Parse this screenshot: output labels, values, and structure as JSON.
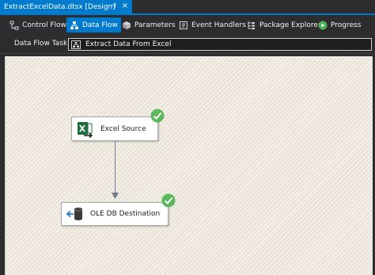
{
  "document_tab": {
    "title": "ExtractExcelData.dtsx [Design]",
    "pin_glyph": "⊣",
    "close_glyph": "×"
  },
  "toolbar": {
    "items": [
      {
        "label": "Control Flow",
        "icon": "control-flow-icon",
        "active": false
      },
      {
        "label": "Data Flow",
        "icon": "data-flow-icon",
        "active": true
      },
      {
        "label": "Parameters",
        "icon": "parameters-icon",
        "active": false
      },
      {
        "label": "Event Handlers",
        "icon": "event-handlers-icon",
        "active": false
      },
      {
        "label": "Package Explorer",
        "icon": "package-explorer-icon",
        "active": false
      },
      {
        "label": "Progress",
        "icon": "progress-play-icon",
        "active": false
      }
    ]
  },
  "task_selector": {
    "label": "Data Flow Task:",
    "value": "Extract Data From Excel",
    "icon": "data-flow-task-icon"
  },
  "canvas": {
    "components": [
      {
        "name": "Excel Source",
        "icon": "excel-source-icon",
        "status": "success"
      },
      {
        "name": "OLE DB Destination",
        "icon": "ole-db-destination-icon",
        "status": "success"
      }
    ]
  },
  "colors": {
    "accent": "#007acc",
    "chrome": "#2d2d30",
    "canvas": "#f3efe6",
    "success": "#5cb85c"
  }
}
